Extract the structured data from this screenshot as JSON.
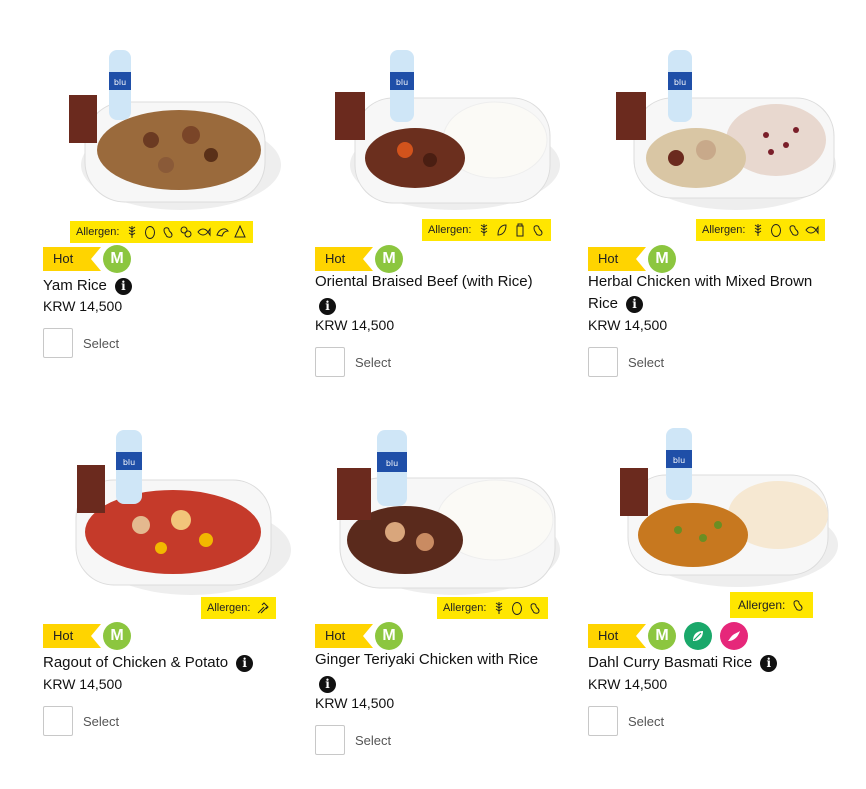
{
  "allergen_label": "Allergen:",
  "badges": {
    "hot": "Hot",
    "meal": "M"
  },
  "select_label": "Select",
  "info_glyph": "i",
  "colors": {
    "hot": "#ffd400",
    "allergen_bg": "#ffe600",
    "meal_badge": "#8cc63f",
    "vegetarian_badge": "#1aa86a",
    "spicy_badge": "#e6277a"
  },
  "meals": [
    {
      "name": "Yam Rice",
      "price": "KRW 14,500",
      "allergens": [
        "wheat-icon",
        "egg-icon",
        "peanut-icon",
        "shellfish-icon",
        "fish-icon",
        "crustacean-icon",
        "mollusc-icon"
      ]
    },
    {
      "name": "Oriental Braised Beef (with Rice)",
      "price": "KRW 14,500",
      "allergens": [
        "wheat-icon",
        "soy-icon",
        "milk-icon",
        "peanut-icon"
      ]
    },
    {
      "name": "Herbal Chicken with Mixed Brown Rice",
      "price": "KRW 14,500",
      "allergens": [
        "wheat-icon",
        "egg-icon",
        "peanut-icon",
        "fish-icon"
      ]
    },
    {
      "name": "Ragout of Chicken & Potato",
      "price": "KRW 14,500",
      "allergens": [
        "celery-icon"
      ]
    },
    {
      "name": "Ginger Teriyaki Chicken with Rice",
      "price": "KRW 14,500",
      "allergens": [
        "wheat-icon",
        "egg-icon",
        "peanut-icon"
      ]
    },
    {
      "name": "Dahl Curry Basmati Rice",
      "price": "KRW 14,500",
      "allergens": [
        "peanut-icon"
      ],
      "extra_badges": [
        "vegetarian-leaf-icon",
        "spicy-chili-icon"
      ]
    }
  ]
}
